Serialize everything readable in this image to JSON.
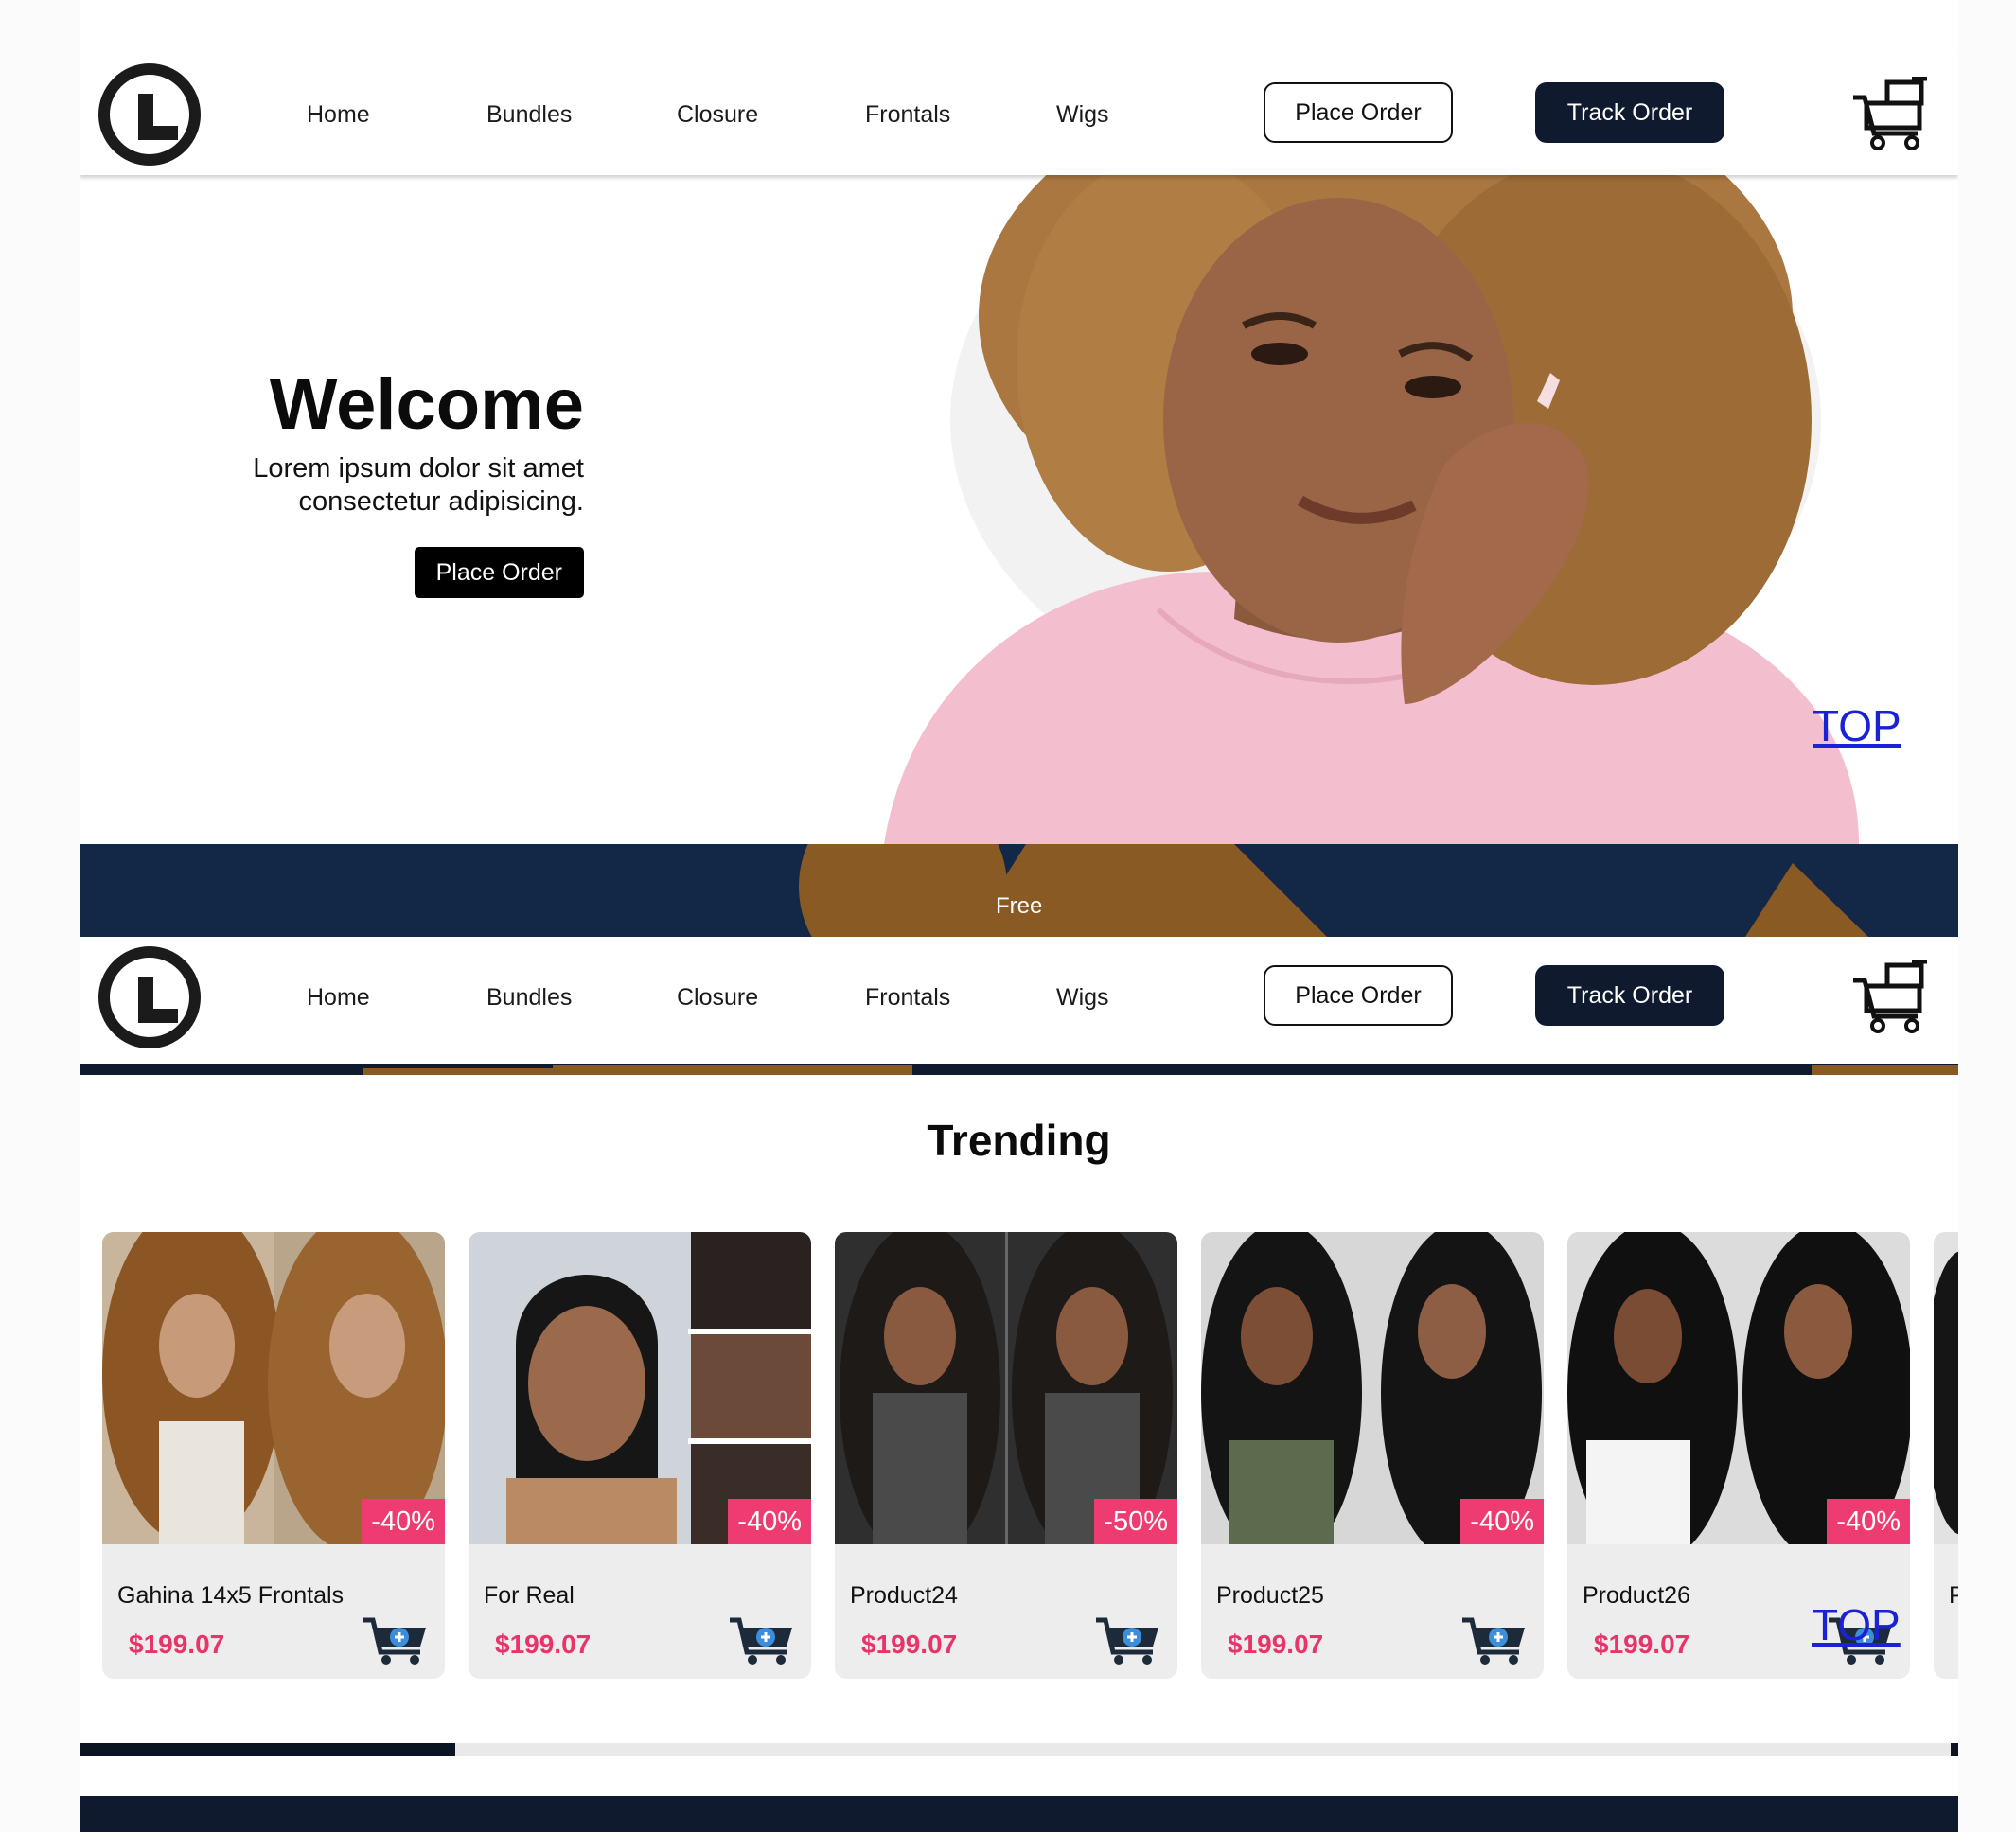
{
  "nav": {
    "menu": [
      "Home",
      "Bundles",
      "Closure",
      "Frontals",
      "Wigs"
    ],
    "place_order": "Place Order",
    "track_order": "Track Order",
    "logo_letter": "L",
    "cart_icon": "cart-icon"
  },
  "hero": {
    "title": "Welcome",
    "subtitle": "Lorem ipsum dolor sit amet consectetur adipisicing.",
    "cta": "Place Order",
    "top_link": "TOP",
    "banner_text": "Free"
  },
  "trending": {
    "title": "Trending",
    "top_link": "TOP",
    "scroll_progress": 0.2,
    "products": [
      {
        "name": "Gahina 14x5 Frontals",
        "price": "$199.07",
        "discount": "-40%",
        "add_icon": "add-to-cart-icon"
      },
      {
        "name": "For Real",
        "price": "$199.07",
        "discount": "-40%",
        "add_icon": "add-to-cart-icon"
      },
      {
        "name": "Product24",
        "price": "$199.07",
        "discount": "-50%",
        "add_icon": "add-to-cart-icon"
      },
      {
        "name": "Product25",
        "price": "$199.07",
        "discount": "-40%",
        "add_icon": "add-to-cart-icon"
      },
      {
        "name": "Product26",
        "price": "$199.07",
        "discount": "-40%",
        "add_icon": "add-to-cart-icon"
      },
      {
        "name": "P",
        "price": "",
        "discount": "",
        "add_icon": "add-to-cart-icon"
      }
    ]
  },
  "colors": {
    "navy": "#0f1a2e",
    "banner": "#132846",
    "discount": "#ee3c73",
    "accent_brown": "#8a5a24",
    "link": "#1a22d6"
  }
}
